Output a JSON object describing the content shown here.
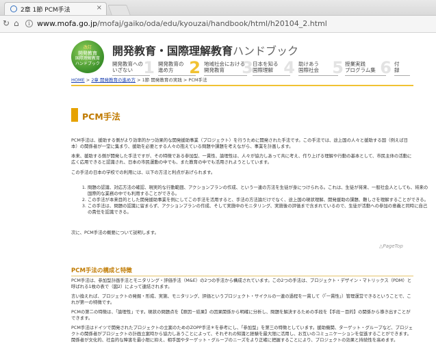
{
  "browser": {
    "tab_title": "2章 1節 PCM手法",
    "tab_close": "×",
    "url_host": "www.mofa.go.jp",
    "url_path": "/mofaj/gaiko/oda/edu/kyouzai/handbook/html/h20104_2.html"
  },
  "header": {
    "logo_line1": "改訂",
    "logo_line2": "開発教育",
    "logo_line3": "国際理解教育",
    "logo_line4": "ハンドブック",
    "title_bold": "開発教育・国際理解教育",
    "title_light": "ハンドブック",
    "chapters": [
      {
        "label": "開発教育への\nいざない",
        "num": "1"
      },
      {
        "label": "開発教育の\n進め方",
        "num": "2"
      },
      {
        "label": "地域社会における\n開発教育",
        "num": "3"
      },
      {
        "label": "日本を知る\n国際理解",
        "num": "4"
      },
      {
        "label": "助けあう\n国際社会",
        "num": "5"
      },
      {
        "label": "授業実践\nプログラム集",
        "num": "6"
      },
      {
        "label": "付\n録",
        "num": ""
      }
    ]
  },
  "breadcrumb": {
    "home": "HOME",
    "sep1": " > ",
    "chapter": "2章 開発教育の進め方",
    "sep2": " > ",
    "section": "1節 開発教育の実践",
    "sep3": " > ",
    "current": "PCM手法"
  },
  "content": {
    "heading": "PCM手法",
    "p1": "PCM手法は、援助する側がより効率的かつ効果的な開発援助事業（プロジェクト）を行うために開発された手法です。この手法では、途上国の人々と援助する国（例えば日本）の関係者が一堂に集まり、援助を必要とする人々の抱えている問題や課題を考えながら、事業を計画します。",
    "p2": "本来、援助する側が開発した手法ですが、その特徴である参加型、一貫性、論理性は、人々が協力しあって共に考え、作り上げる理解や行動の基本として、市民主体の活動に広く応用できると認識され、日本の市民運動の中でも、また教育の中でも活用されようとしています。",
    "p3": "この手法の日本の学校での利用には、以下の方法と利点があげられます。",
    "list": [
      "問題の認識、対応方法の確認、現実的な行動範囲、アクションプランの作成、という一連の方法を生徒が身につけられる。これは、生徒が将来、一般社会人としても、将来の国際的な業務の中でも利用することができる。",
      "この手法が本来目的とした開発援助事業を例にしてこの手法を活用すると、手法の方法論だけでなく、途上国の現状理解、開発援助の課題、難しさを理解することができる。",
      "この手法は、問題の認識に留まらず、アクションプランの作成、そして実施中のモニタリング、実施後の評価まで含まれているので、生徒が活動への参加の意義と同時に自己の責任を認識できる。"
    ],
    "p4": "次に、PCM手法の概要について説明します。",
    "pagetop": "△PageTop",
    "h2": "PCM手法の構成と特徴",
    "p5": "PCM手法は、参加型計画手法とモニタリング・評価手法（M&E）の2つの手法から構成されています。この2つの手法は、プロジェクト・デザイン・マトリックス（PDM）と呼ばれる1枚の表で（図2）によって連結されます。",
    "p6": "言い換えれば、プロジェクトの発掘・形成、実施、モニタリング、評価というプロジェクト・サイクルの一連の過程を一貫して（「一貫性」）管理運営できるということで、これが第一の特徴です。",
    "p7": "PCMの第二の特徴は、「論理性」です。現状の問題点を【原因－結果】の因果関係から明確に分析し、問題を解決するための手段を【手段－目的】の関係から導き出すことができます。",
    "p8": "PCM手法はドイツで開発されたプロジェクトの立案のためのZOPP手法＊を参考にし、「参加型」を第三の特徴としています。援助機関、ターゲット・グループなど、プロジェクトの関係者がプロジェクトの計画立案時から協力しあうことによって、それぞれの知識と経験を最大限に活用し、お互いのコミュニケーションを促進することができます。関係者が文化的、社会的な障害を最小限に抑え、相手国やターゲット・グループのニーズをより正確に把握することにより、プロジェクトの効果と持続性を高めます。"
  }
}
